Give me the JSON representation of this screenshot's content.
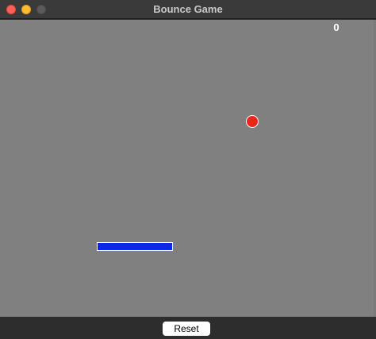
{
  "window": {
    "title": "Bounce Game"
  },
  "game": {
    "score": "0",
    "colors": {
      "background": "#808080",
      "ball": "#e8261a",
      "paddle": "#0a28e6"
    }
  },
  "controls": {
    "reset_label": "Reset"
  }
}
